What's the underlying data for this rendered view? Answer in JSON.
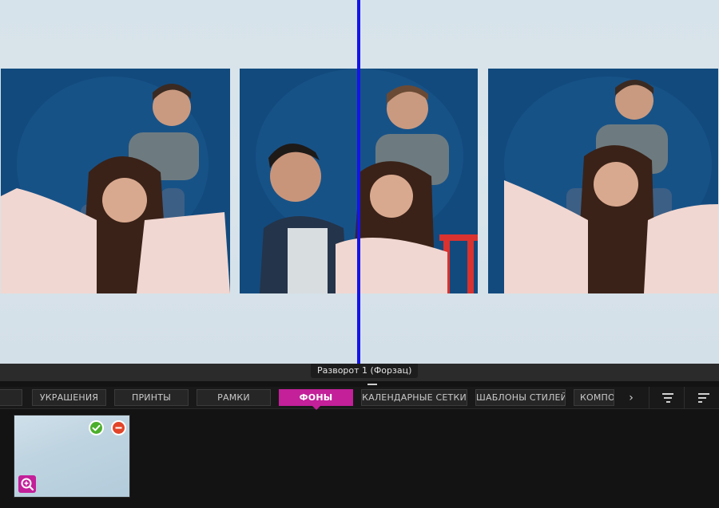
{
  "spread": {
    "label": "Разворот 1 (Форзац)",
    "photos": [
      {
        "name": "family-photo-1"
      },
      {
        "name": "family-photo-2"
      },
      {
        "name": "family-photo-3"
      }
    ]
  },
  "tabs": {
    "items": [
      {
        "label": "УКРАШЕНИЯ",
        "active": false
      },
      {
        "label": "ПРИНТЫ",
        "active": false
      },
      {
        "label": "РАМКИ",
        "active": false
      },
      {
        "label": "ФОНЫ",
        "active": true
      },
      {
        "label": "КАЛЕНДАРНЫЕ СЕТКИ",
        "active": false
      },
      {
        "label": "ШАБЛОНЫ СТИЛЕЙ",
        "active": false
      },
      {
        "label": "КОМПО",
        "active": false
      }
    ],
    "scroll_right_icon": "chevron-right-icon",
    "filter_icon": "filter-icon",
    "sort_icon": "sort-icon"
  },
  "panel": {
    "thumbnail_icons": [
      "check-circle-icon",
      "minus-circle-icon",
      "zoom-in-icon"
    ]
  },
  "colors": {
    "accent": "#c3209a",
    "divider": "#1414e8",
    "apply": "#4caf2b",
    "remove": "#e2452a",
    "background": "#131313"
  }
}
